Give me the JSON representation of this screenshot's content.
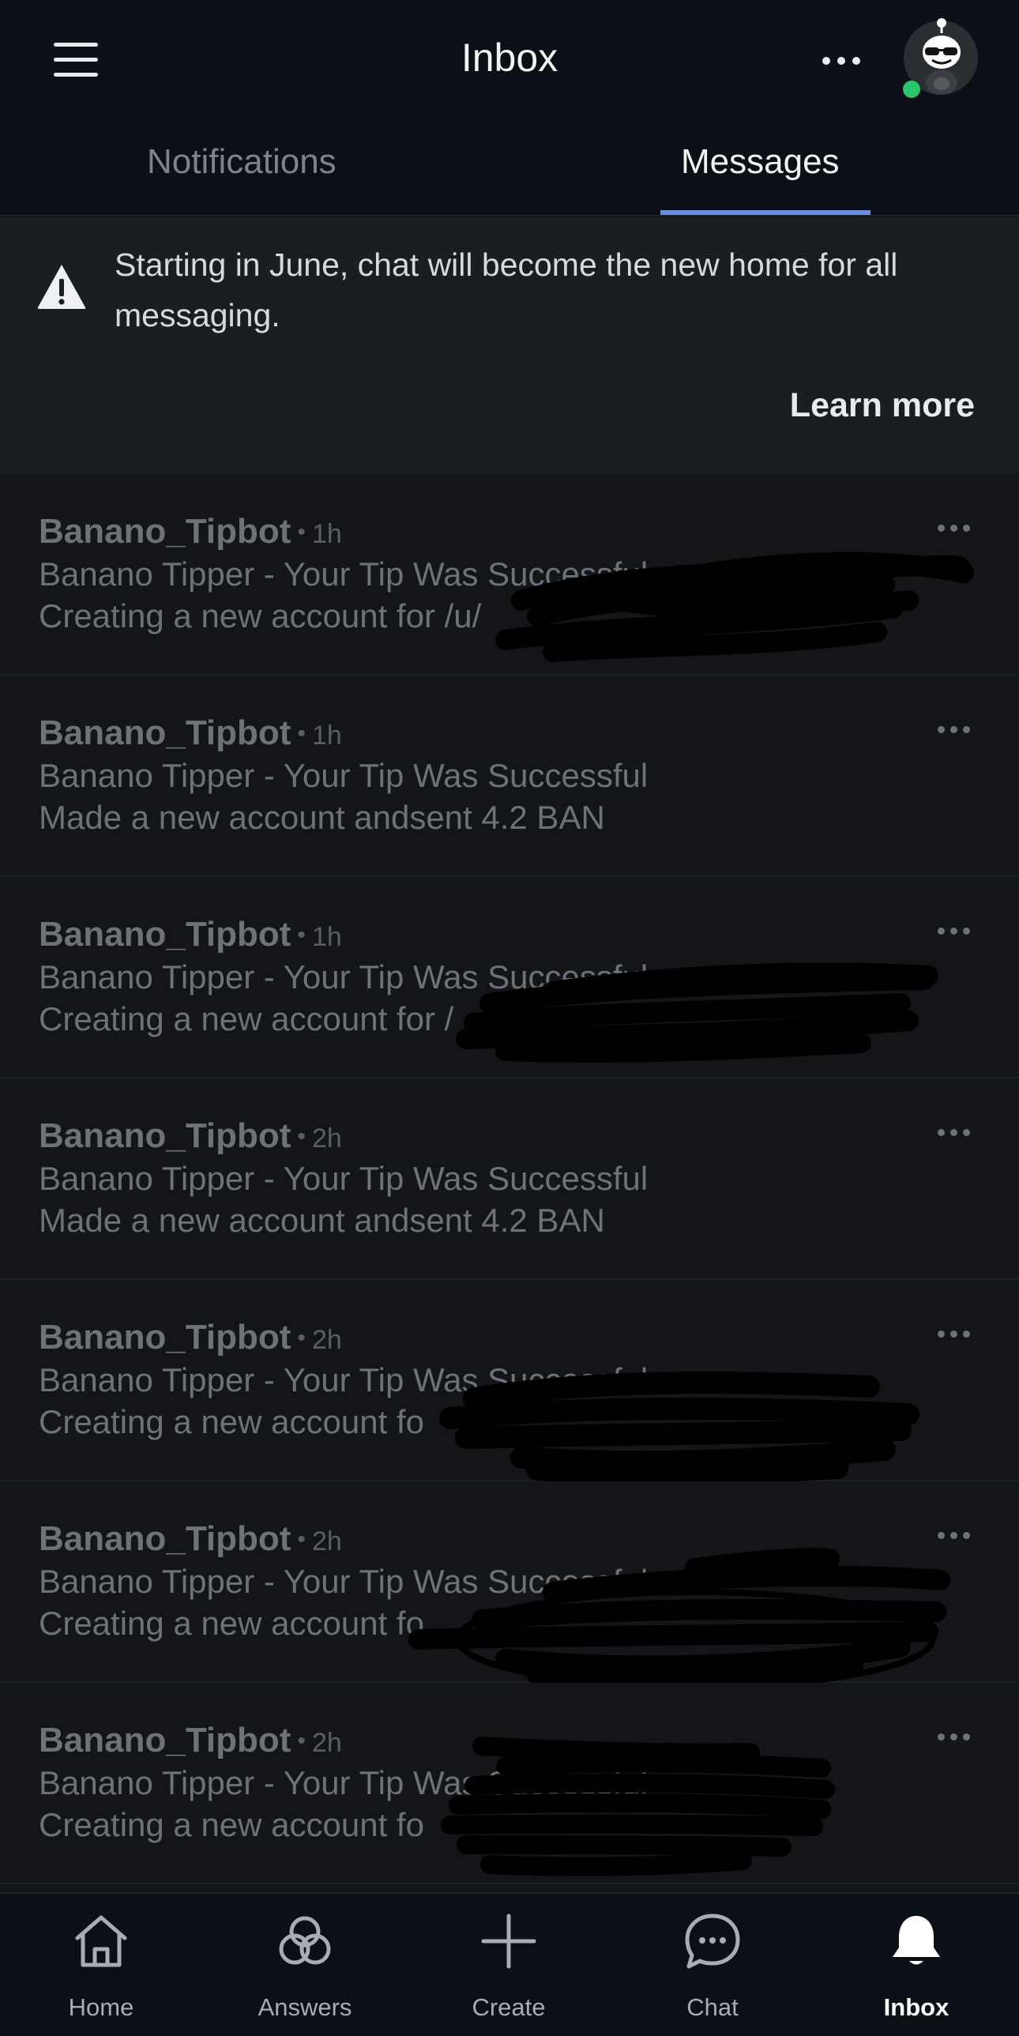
{
  "header": {
    "title": "Inbox",
    "menu_icon": "hamburger-menu-icon",
    "more_icon": "horizontal-ellipsis-icon",
    "avatar_status": "online",
    "status_color": "#2bc46b"
  },
  "tabs": [
    {
      "label": "Notifications",
      "selected": false
    },
    {
      "label": "Messages",
      "selected": true
    }
  ],
  "accent_color": "#6b8fe0",
  "banner": {
    "icon": "warning-triangle-icon",
    "text": "Starting in June, chat will become the new home for all messaging.",
    "action_label": "Learn more"
  },
  "messages": [
    {
      "author": "Banano_Tipbot",
      "time": "1h",
      "subject": "Banano Tipper - Your Tip Was Successful",
      "body": "Creating a new account for /u/",
      "redacted": true
    },
    {
      "author": "Banano_Tipbot",
      "time": "1h",
      "subject": "Banano Tipper - Your Tip Was Successful",
      "body": "Made a new account andsent 4.2 BAN",
      "redacted": false
    },
    {
      "author": "Banano_Tipbot",
      "time": "1h",
      "subject": "Banano Tipper - Your Tip Was Successful",
      "body": "Creating a new account for /",
      "redacted": true
    },
    {
      "author": "Banano_Tipbot",
      "time": "2h",
      "subject": "Banano Tipper - Your Tip Was Successful",
      "body": "Made a new account andsent 4.2 BAN",
      "redacted": false
    },
    {
      "author": "Banano_Tipbot",
      "time": "2h",
      "subject": "Banano Tipper - Your Tip Was Successful",
      "body": "Creating a new account fo",
      "redacted": true
    },
    {
      "author": "Banano_Tipbot",
      "time": "2h",
      "subject": "Banano Tipper - Your Tip Was Successful",
      "body": "Creating a new account fo",
      "redacted": true
    },
    {
      "author": "Banano_Tipbot",
      "time": "2h",
      "subject": "Banano Tipper - Your Tip Was Successful",
      "body": "Creating a new account fo",
      "redacted": true
    }
  ],
  "bottom_nav": [
    {
      "label": "Home",
      "icon": "home-icon",
      "active": false
    },
    {
      "label": "Answers",
      "icon": "answers-icon",
      "active": false
    },
    {
      "label": "Create",
      "icon": "plus-icon",
      "active": false
    },
    {
      "label": "Chat",
      "icon": "chat-bubble-icon",
      "active": false
    },
    {
      "label": "Inbox",
      "icon": "bell-icon",
      "active": true
    }
  ]
}
